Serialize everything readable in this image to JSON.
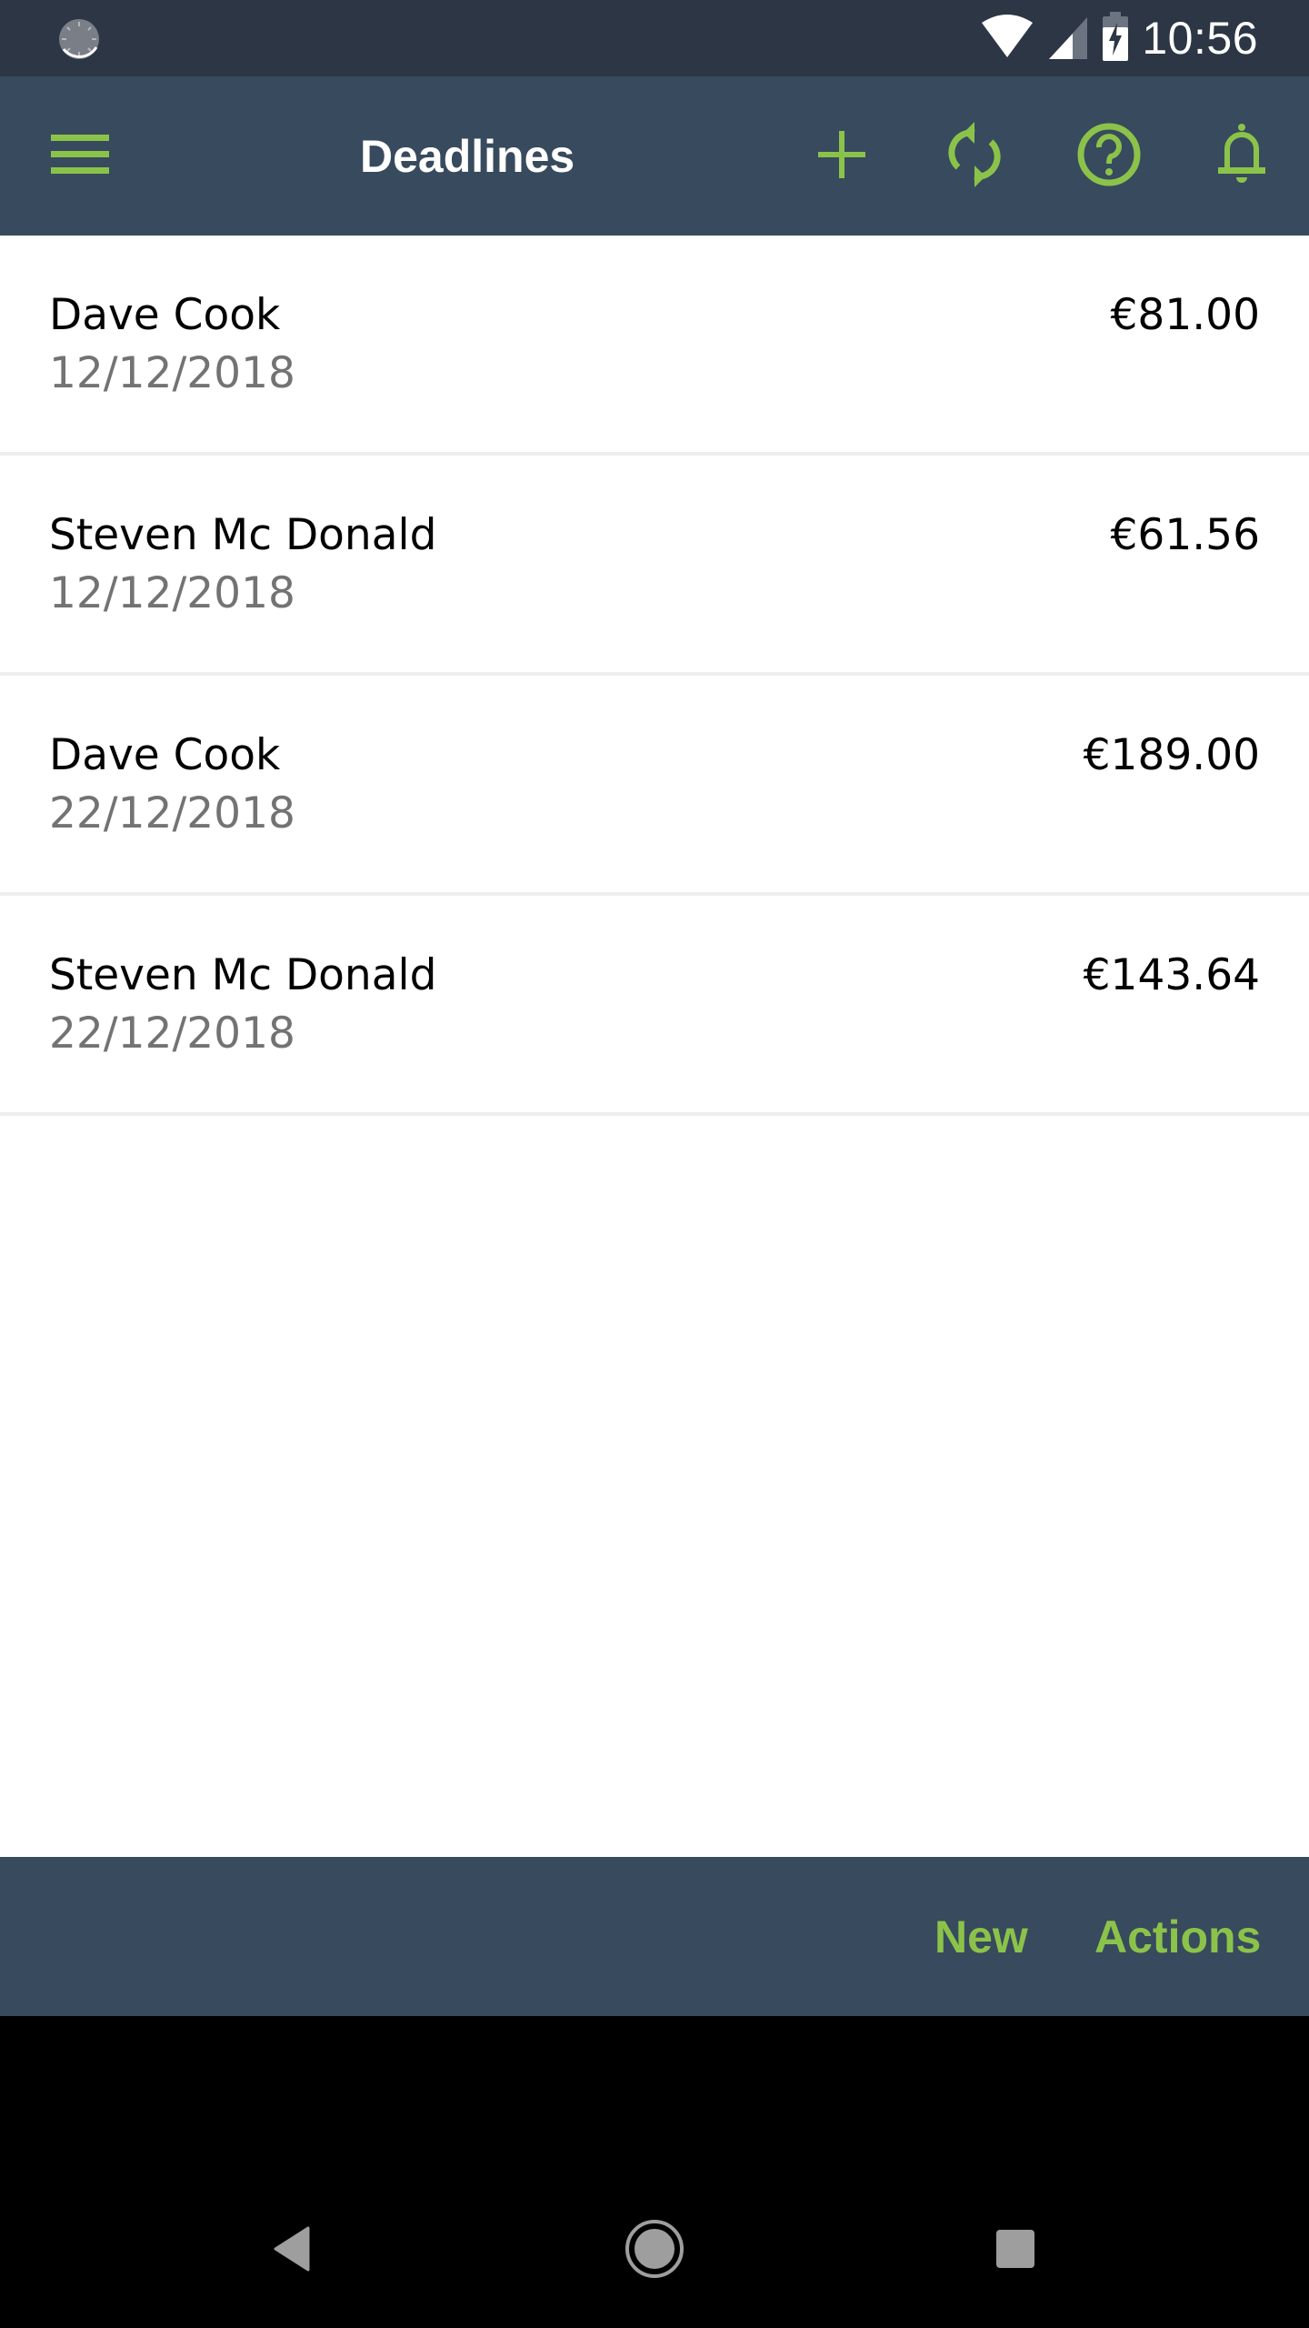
{
  "status_bar": {
    "time": "10:56",
    "icons": [
      "sync-progress-icon",
      "wifi-icon",
      "cell-signal-icon",
      "battery-charging-icon"
    ]
  },
  "app_bar": {
    "title": "Deadlines",
    "menu_icon": "hamburger-menu-icon",
    "actions": [
      {
        "name": "add",
        "icon": "plus-icon"
      },
      {
        "name": "refresh",
        "icon": "sync-icon"
      },
      {
        "name": "help",
        "icon": "help-circle-icon"
      },
      {
        "name": "notifications",
        "icon": "bell-icon"
      }
    ]
  },
  "colors": {
    "status_bar_bg": "#2c3644",
    "app_bar_bg": "#384a5d",
    "accent": "#8bc34a",
    "secondary_text": "#737373",
    "divider": "#eeeeee"
  },
  "deadlines": [
    {
      "name": "Dave Cook",
      "date": "12/12/2018",
      "amount": "€81.00"
    },
    {
      "name": "Steven Mc Donald",
      "date": "12/12/2018",
      "amount": "€61.56"
    },
    {
      "name": "Dave Cook",
      "date": "22/12/2018",
      "amount": "€189.00"
    },
    {
      "name": "Steven Mc Donald",
      "date": "22/12/2018",
      "amount": "€143.64"
    }
  ],
  "footer": {
    "new_label": "New",
    "actions_label": "Actions"
  },
  "nav_bar": {
    "buttons": [
      "back-icon",
      "home-icon",
      "recents-icon"
    ]
  }
}
